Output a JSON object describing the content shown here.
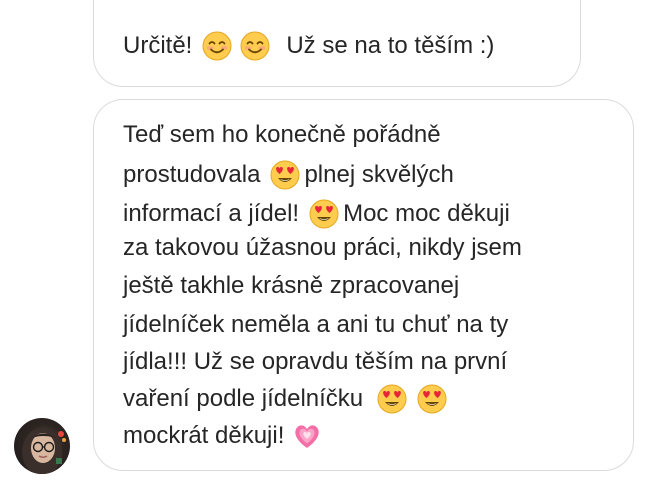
{
  "messages": {
    "top": {
      "before": "Určitě!",
      "after": "Už se na to těším :)",
      "emojis": [
        "smiling-face-icon",
        "smiling-face-icon"
      ]
    },
    "main": {
      "line1": "Teď sem ho konečně pořádně",
      "line2_a": "prostudovala",
      "line2_b": "plnej skvělých",
      "line3_a": "informací a jídel!",
      "line3_b": "Moc moc děkuji",
      "line4": "za takovou úžasnou práci, nikdy jsem",
      "line5": "ještě takhle krásně zpracovanej",
      "line6": "jídelníček neměla a ani tu chuť na ty",
      "line7": "jídla!!! Už se opravdu těším na první",
      "line8": "vaření podle jídelníčku",
      "line9": "mockrát děkuji!",
      "emojis": [
        "heart-eyes-icon",
        "heart-eyes-icon",
        "heart-eyes-icon",
        "heart-eyes-icon",
        "growing-heart-icon"
      ]
    }
  },
  "colors": {
    "text": "#262626",
    "bubble_border": "#dbdbdb",
    "emoji_yellow": "#ffcc4d",
    "heart_red": "#e8243b",
    "heart_pink": "#f36fa6"
  }
}
